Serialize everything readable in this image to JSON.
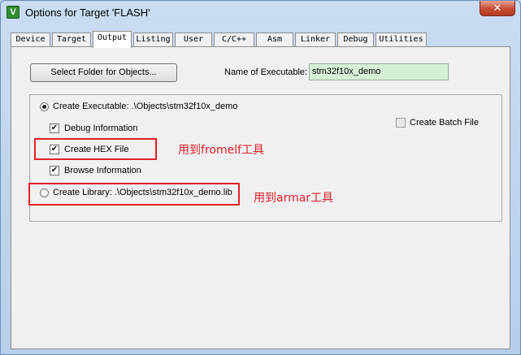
{
  "window": {
    "title": "Options for Target 'FLASH'",
    "app_icon_glyph": "V",
    "close_glyph": "✕"
  },
  "tabs": [
    {
      "label": "Device"
    },
    {
      "label": "Target"
    },
    {
      "label": "Output"
    },
    {
      "label": "Listing"
    },
    {
      "label": "User"
    },
    {
      "label": "C/C++"
    },
    {
      "label": "Asm"
    },
    {
      "label": "Linker"
    },
    {
      "label": "Debug"
    },
    {
      "label": "Utilities"
    }
  ],
  "active_tab": "Output",
  "output": {
    "select_folder_button": "Select Folder for Objects...",
    "name_of_executable_label": "Name of Executable:",
    "name_of_executable_value": "stm32f10x_demo",
    "create_executable_label": "Create Executable:  .\\Objects\\stm32f10x_demo",
    "debug_information_label": "Debug Information",
    "create_hex_file_label": "Create HEX File",
    "browse_information_label": "Browse Information",
    "create_library_label": "Create Library:  .\\Objects\\stm32f10x_demo.lib",
    "create_batch_file_label": "Create Batch File",
    "check_glyph": "✔"
  },
  "annotations": {
    "hex_note": "用到fromelf工具",
    "lib_note": "用到armar工具",
    "color": "#e3212a"
  }
}
